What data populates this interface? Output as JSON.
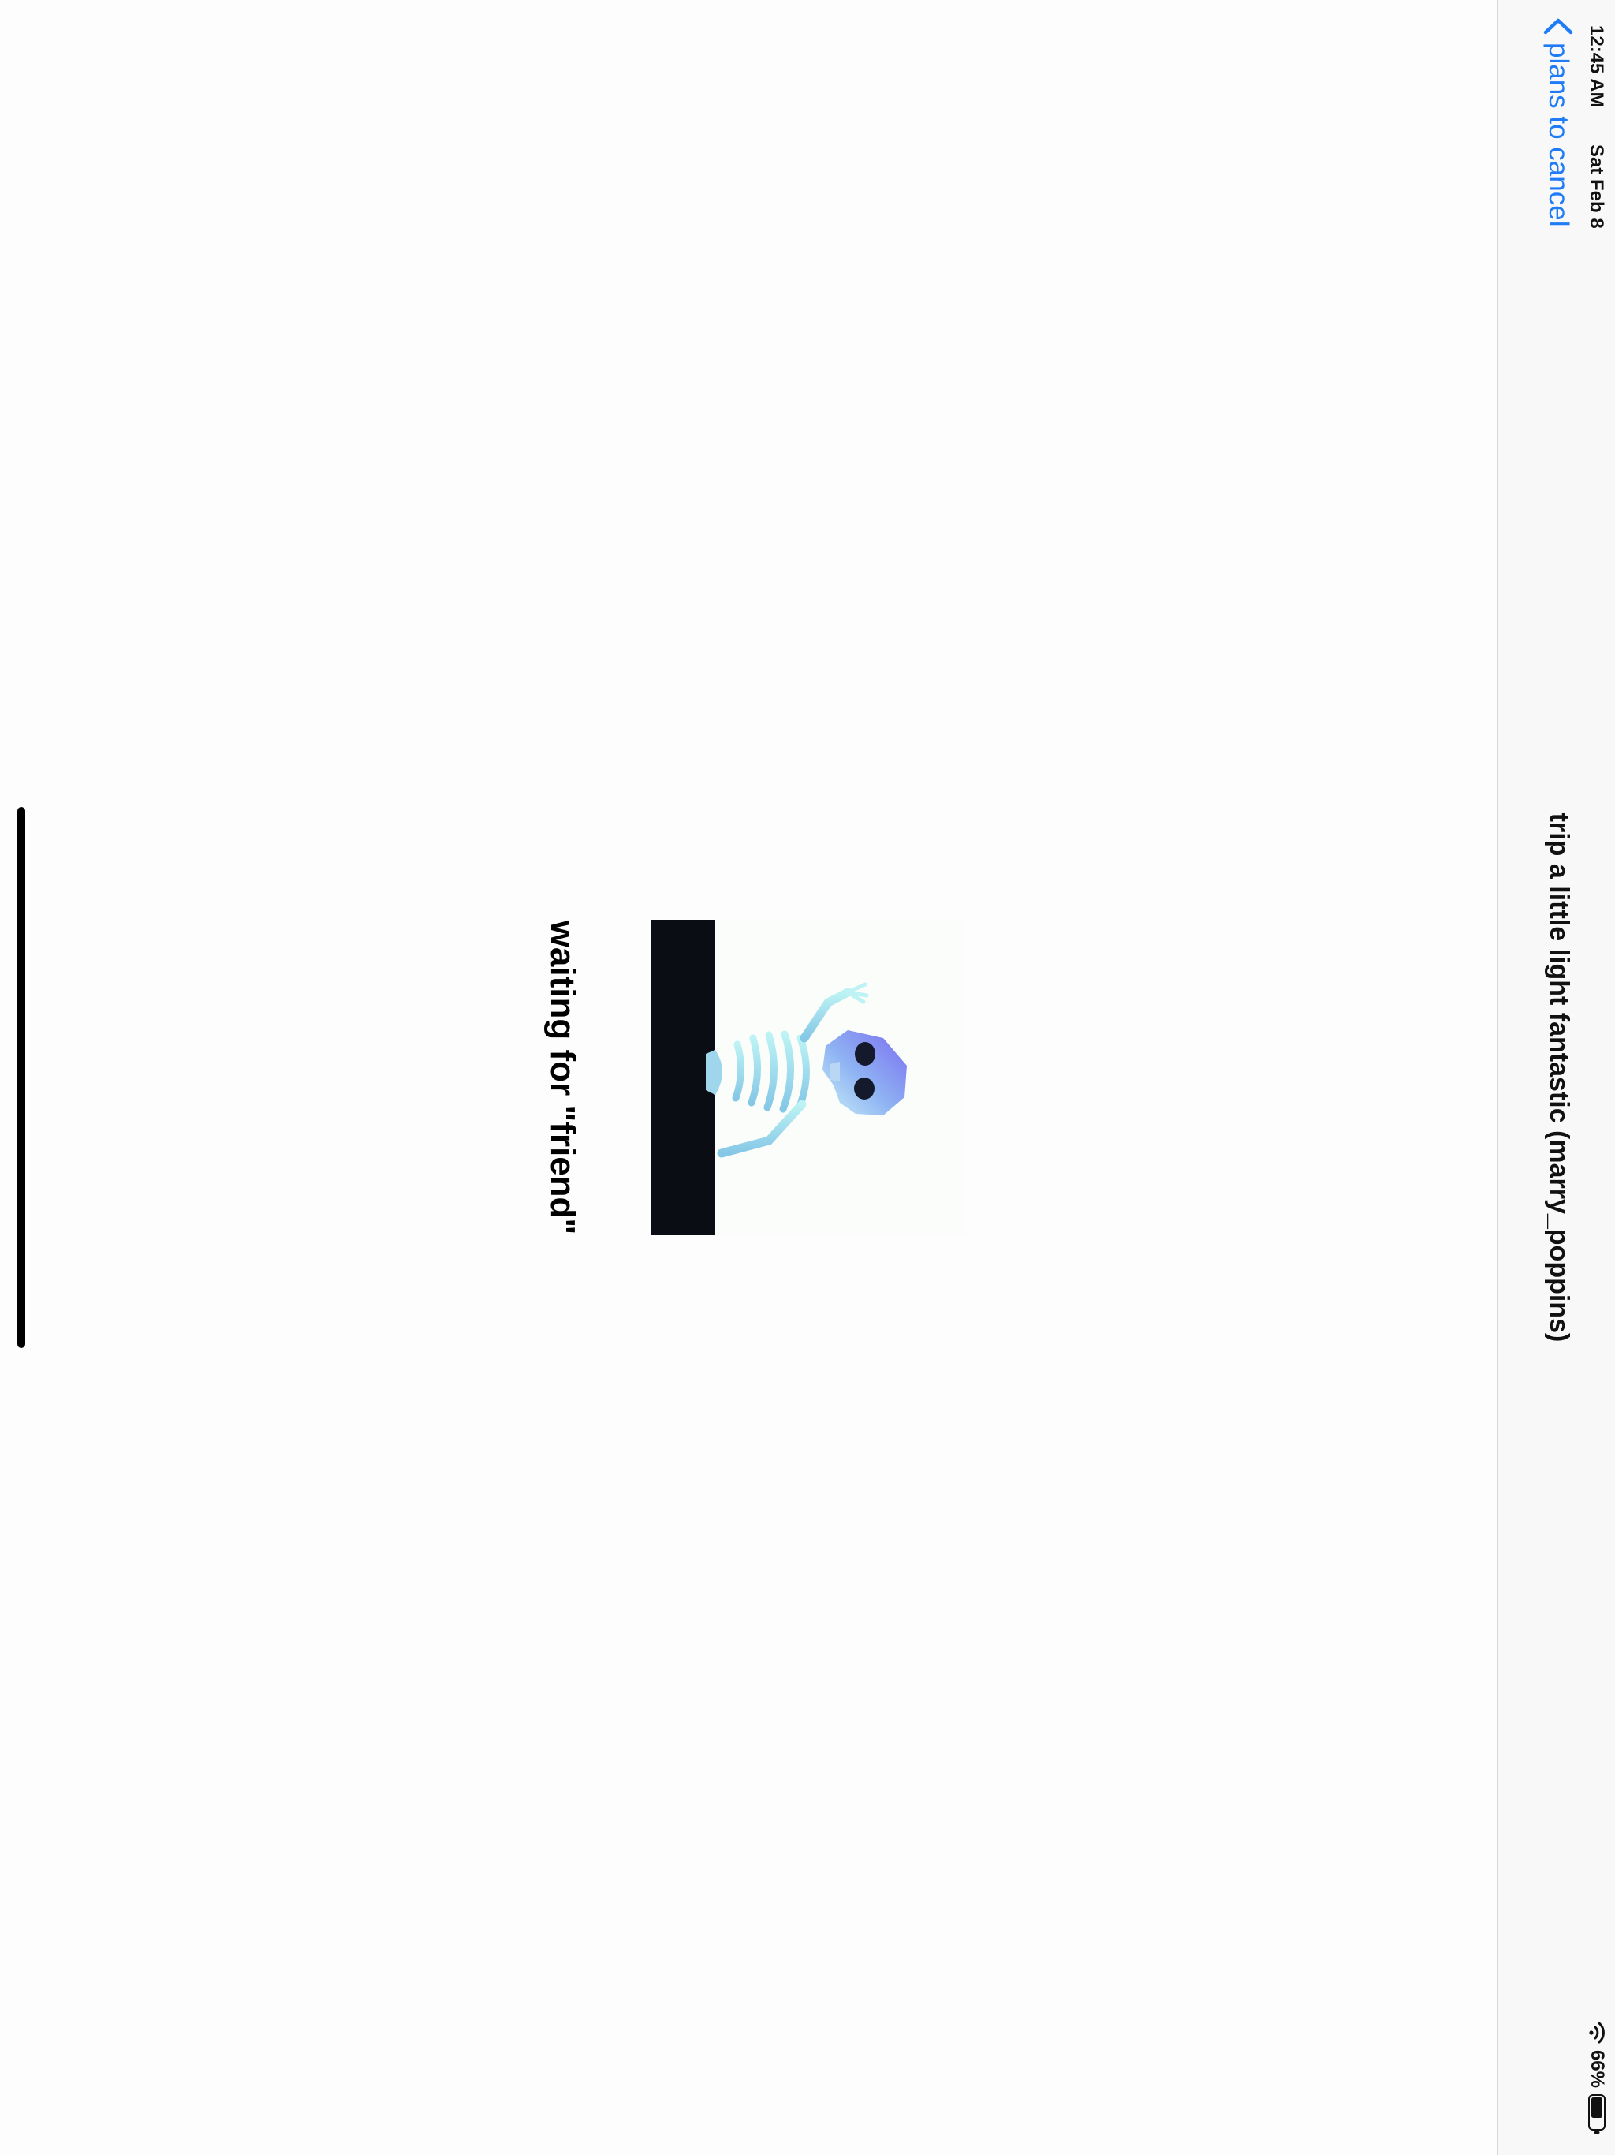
{
  "status_bar": {
    "time": "12:45 AM",
    "date": "Sat Feb 8",
    "battery_percent": "66%",
    "wifi_icon": "wifi-icon",
    "battery_icon": "battery-icon"
  },
  "nav": {
    "back_label": "plans to cancel",
    "back_icon": "chevron-left-icon",
    "title": "trip a little light fantastic (marry_poppins)"
  },
  "content": {
    "image_description_icon": "skeleton-gif",
    "caption": "waiting for \"friend\""
  },
  "colors": {
    "accent": "#1f7cf6",
    "background": "#fdfdfd",
    "nav_background": "#f8f8f8",
    "gif_floor": "#0a0d14"
  }
}
